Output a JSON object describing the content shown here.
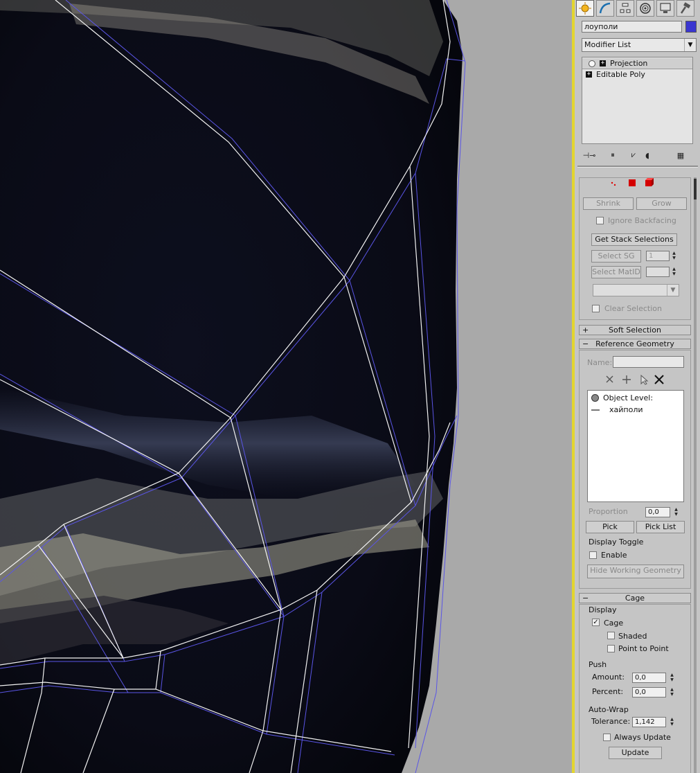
{
  "command_panel": {
    "tabs": [
      {
        "name": "create-tab",
        "icon": "sun-star-icon",
        "active": true
      },
      {
        "name": "modify-tab",
        "icon": "curve-icon",
        "active": false
      },
      {
        "name": "hierarchy-tab",
        "icon": "hierarchy-icon",
        "active": false
      },
      {
        "name": "motion-tab",
        "icon": "motion-icon",
        "active": false
      },
      {
        "name": "display-tab",
        "icon": "monitor-icon",
        "active": false
      },
      {
        "name": "utilities-tab",
        "icon": "hammer-icon",
        "active": false
      }
    ],
    "object_name": "лоуполи",
    "object_color": "#3a36d0",
    "modifier_list": "Modifier List",
    "stack": [
      {
        "label": "Projection",
        "selected": true
      },
      {
        "label": "Editable Poly",
        "selected": false
      }
    ]
  },
  "selection": {
    "shrink": "Shrink",
    "grow": "Grow",
    "ignore_backfacing": "Ignore Backfacing",
    "get_stack_selections": "Get Stack Selections",
    "select_sg": "Select SG",
    "select_sg_value": "1",
    "select_matid": "Select MatID",
    "clear_selection": "Clear Selection"
  },
  "soft_selection": {
    "title": "Soft Selection",
    "collapsed": true
  },
  "reference_geometry": {
    "title": "Reference Geometry",
    "name_label": "Name:",
    "name_value": "",
    "object_level_label": "Object Level:",
    "items": [
      "хайполи"
    ],
    "proportion_label": "Proportion",
    "proportion_value": "0,0",
    "pick": "Pick",
    "pick_list": "Pick List",
    "display_toggle": "Display Toggle",
    "enable": "Enable",
    "hide_working_geometry": "Hide Working Geometry"
  },
  "cage": {
    "title": "Cage",
    "display_label": "Display",
    "cage_label": "Cage",
    "cage_checked": true,
    "shaded_label": "Shaded",
    "point_to_point_label": "Point to Point",
    "push_label": "Push",
    "amount_label": "Amount:",
    "amount_value": "0,0",
    "percent_label": "Percent:",
    "percent_value": "0,0",
    "autowrap_label": "Auto-Wrap",
    "tolerance_label": "Tolerance:",
    "tolerance_value": "1,142",
    "always_update_label": "Always Update",
    "update_button": "Update"
  }
}
